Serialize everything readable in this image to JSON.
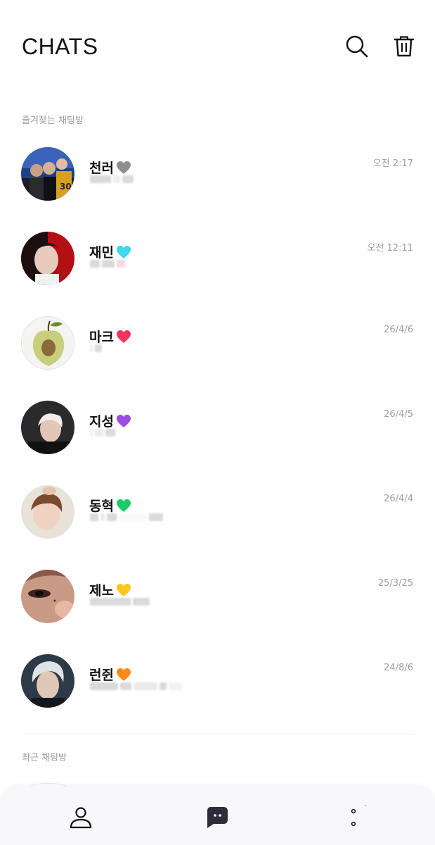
{
  "header": {
    "title": "CHATS"
  },
  "sections": {
    "favorites_label": "즐겨찾는 채팅방",
    "recent_label": "최근 채팅방"
  },
  "chats": [
    {
      "name": "천러",
      "time": "오전 2:17",
      "heart": "gray-heart",
      "heart_color": "#8e8e8e"
    },
    {
      "name": "재민",
      "time": "오전 12:11",
      "heart": "cyan-heart",
      "heart_color": "#3fd6ee"
    },
    {
      "name": "마크",
      "time": "26/4/6",
      "heart": "red-heart",
      "heart_color": "#f2335c"
    },
    {
      "name": "지성",
      "time": "26/4/5",
      "heart": "purple-heart",
      "heart_color": "#9a4de0"
    },
    {
      "name": "동혁",
      "time": "26/4/4",
      "heart": "green-heart",
      "heart_color": "#1ec86a"
    },
    {
      "name": "제노",
      "time": "25/3/25",
      "heart": "yellow-heart",
      "heart_color": "#ffc61c"
    },
    {
      "name": "런쥔",
      "time": "24/8/6",
      "heart": "orange-heart",
      "heart_color": "#ff8a1c"
    }
  ],
  "icons": {
    "search": "search-icon",
    "trash": "trash-icon",
    "nav_friends": "person-icon",
    "nav_chats": "chat-bubble-icon",
    "nav_more": "more-dots-icon"
  },
  "colors": {
    "accent": "#8a4cf0",
    "chat_icon": "#2d2d3a"
  }
}
